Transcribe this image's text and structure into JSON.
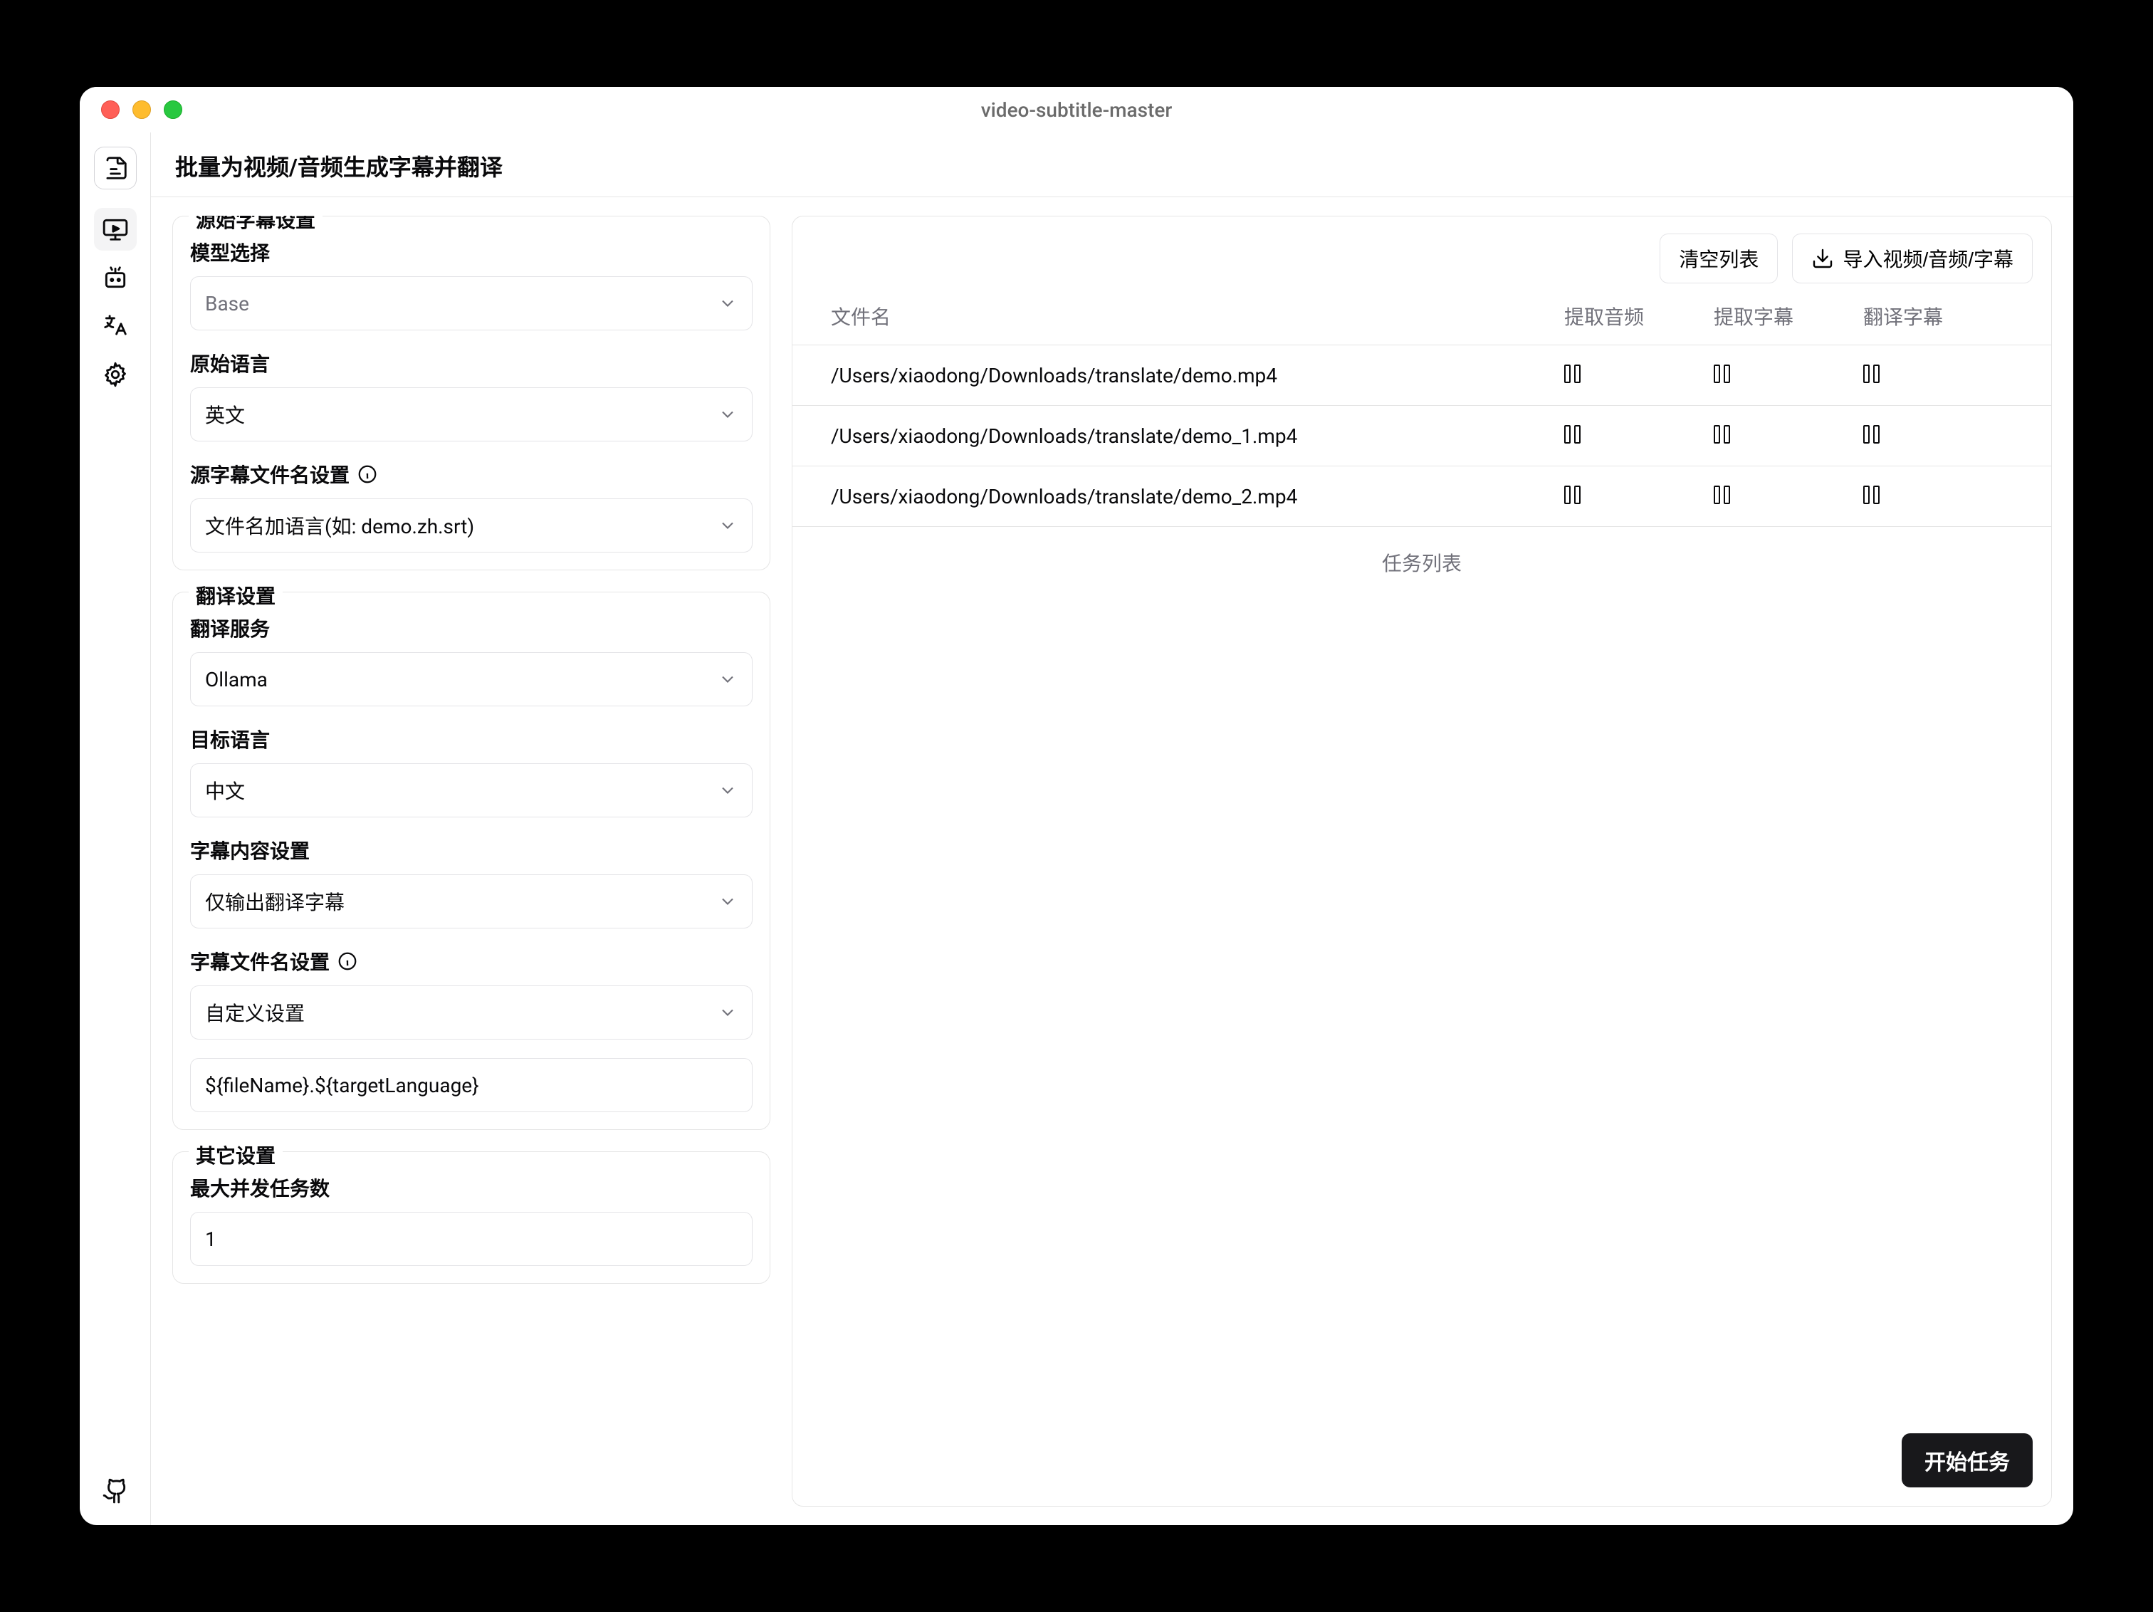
{
  "window": {
    "title": "video-subtitle-master"
  },
  "header": {
    "title": "批量为视频/音频生成字幕并翻译"
  },
  "panels": {
    "source": {
      "legend": "源始字幕设置",
      "model": {
        "label": "模型选择",
        "value": "Base"
      },
      "sourceLang": {
        "label": "原始语言",
        "value": "英文"
      },
      "sourceFilename": {
        "label": "源字幕文件名设置",
        "value": "文件名加语言(如: demo.zh.srt)"
      }
    },
    "translate": {
      "legend": "翻译设置",
      "service": {
        "label": "翻译服务",
        "value": "Ollama"
      },
      "targetLang": {
        "label": "目标语言",
        "value": "中文"
      },
      "content": {
        "label": "字幕内容设置",
        "value": "仅输出翻译字幕"
      },
      "filename": {
        "label": "字幕文件名设置",
        "value": "自定义设置"
      },
      "template": {
        "value": "${fileName}.${targetLanguage}"
      }
    },
    "other": {
      "legend": "其它设置",
      "concurrency": {
        "label": "最大并发任务数",
        "value": "1"
      }
    }
  },
  "right": {
    "buttons": {
      "clear": "清空列表",
      "import": "导入视频/音频/字幕"
    },
    "columns": {
      "fname": "文件名",
      "extractAudio": "提取音频",
      "extractSub": "提取字幕",
      "translateSub": "翻译字幕"
    },
    "rows": [
      {
        "fname": "/Users/xiaodong/Downloads/translate/demo.mp4"
      },
      {
        "fname": "/Users/xiaodong/Downloads/translate/demo_1.mp4"
      },
      {
        "fname": "/Users/xiaodong/Downloads/translate/demo_2.mp4"
      }
    ],
    "taskListLabel": "任务列表",
    "start": "开始任务"
  }
}
